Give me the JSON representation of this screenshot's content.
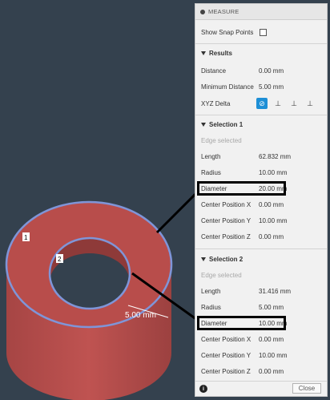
{
  "panel": {
    "title": "MEASURE",
    "show_snap_points": "Show Snap Points",
    "results": {
      "header": "Results",
      "distance_label": "Distance",
      "distance_value": "0.00 mm",
      "min_distance_label": "Minimum Distance",
      "min_distance_value": "5.00 mm",
      "xyz_delta_label": "XYZ Delta"
    },
    "selection1": {
      "header": "Selection 1",
      "type": "Edge selected",
      "length_label": "Length",
      "length_value": "62.832 mm",
      "radius_label": "Radius",
      "radius_value": "10.00 mm",
      "diameter_label": "Diameter",
      "diameter_value": "20.00 mm",
      "cpx_label": "Center Position X",
      "cpx_value": "0.00 mm",
      "cpy_label": "Center Position Y",
      "cpy_value": "10.00 mm",
      "cpz_label": "Center Position Z",
      "cpz_value": "0.00 mm"
    },
    "selection2": {
      "header": "Selection 2",
      "type": "Edge selected",
      "length_label": "Length",
      "length_value": "31.416 mm",
      "radius_label": "Radius",
      "radius_value": "5.00 mm",
      "diameter_label": "Diameter",
      "diameter_value": "10.00 mm",
      "cpx_label": "Center Position X",
      "cpx_value": "0.00 mm",
      "cpy_label": "Center Position Y",
      "cpy_value": "10.00 mm",
      "cpz_label": "Center Position Z",
      "cpz_value": "0.00 mm"
    },
    "footer": {
      "info": "i",
      "close": "Close"
    }
  },
  "viewport": {
    "marker1": "1",
    "marker2": "2",
    "dimension": "5.00 mm"
  },
  "colors": {
    "background": "#34414e",
    "part_red": "#b84d4b",
    "edge_blue": "#7f95d8",
    "active_blue": "#1e8fd6"
  }
}
